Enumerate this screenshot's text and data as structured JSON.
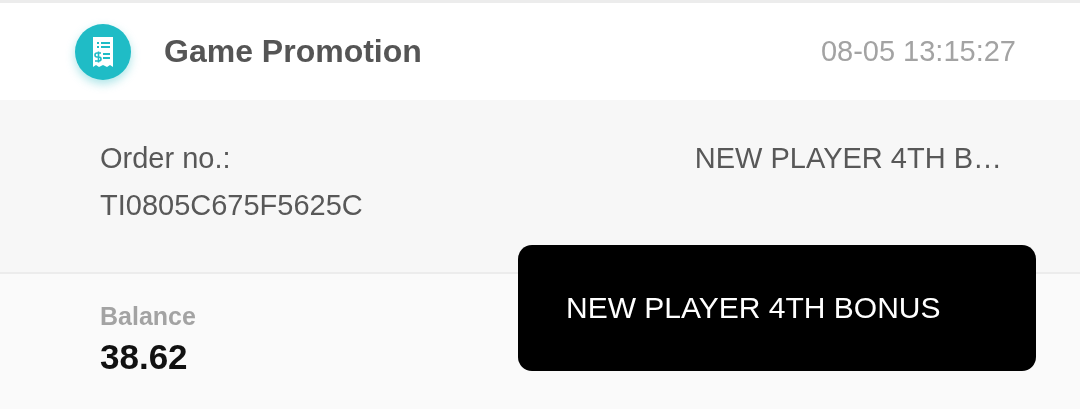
{
  "header": {
    "title": "Game Promotion",
    "time": "08-05 13:15:27"
  },
  "order": {
    "label": "Order no.:",
    "number": "TI0805C675F5625C",
    "promotion": "NEW PLAYER 4TH B…"
  },
  "balance": {
    "label": "Balance",
    "value": "38.62"
  },
  "toast": {
    "text": "NEW PLAYER 4TH BONUS"
  }
}
